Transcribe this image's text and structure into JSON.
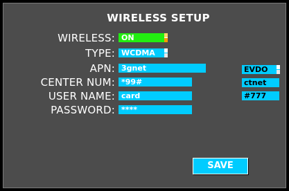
{
  "header": {
    "title": "WIRELESS SETUP"
  },
  "form": {
    "wireless_label": "WIRELESS:",
    "wireless_value": "ON",
    "type_label": "TYPE:",
    "type_value": "WCDMA",
    "apn_label": "APN:",
    "apn_value": "3gnet",
    "center_num_label": "CENTER NUM:",
    "center_num_value": "*99#",
    "user_name_label": "USER NAME:",
    "user_name_value": "card",
    "password_label": "PASSWORD:",
    "password_value": "****"
  },
  "evdo": {
    "type_value": "EVDO",
    "apn_value": "ctnet",
    "center_num_value": "#777"
  },
  "actions": {
    "save_label": "SAVE"
  },
  "colors": {
    "background": "#4c4c4c",
    "field": "#00ccff",
    "toggle_on": "#22ee11",
    "spinner": "#ff9a00"
  },
  "icons": [
    "spinner-arrows-icon"
  ]
}
